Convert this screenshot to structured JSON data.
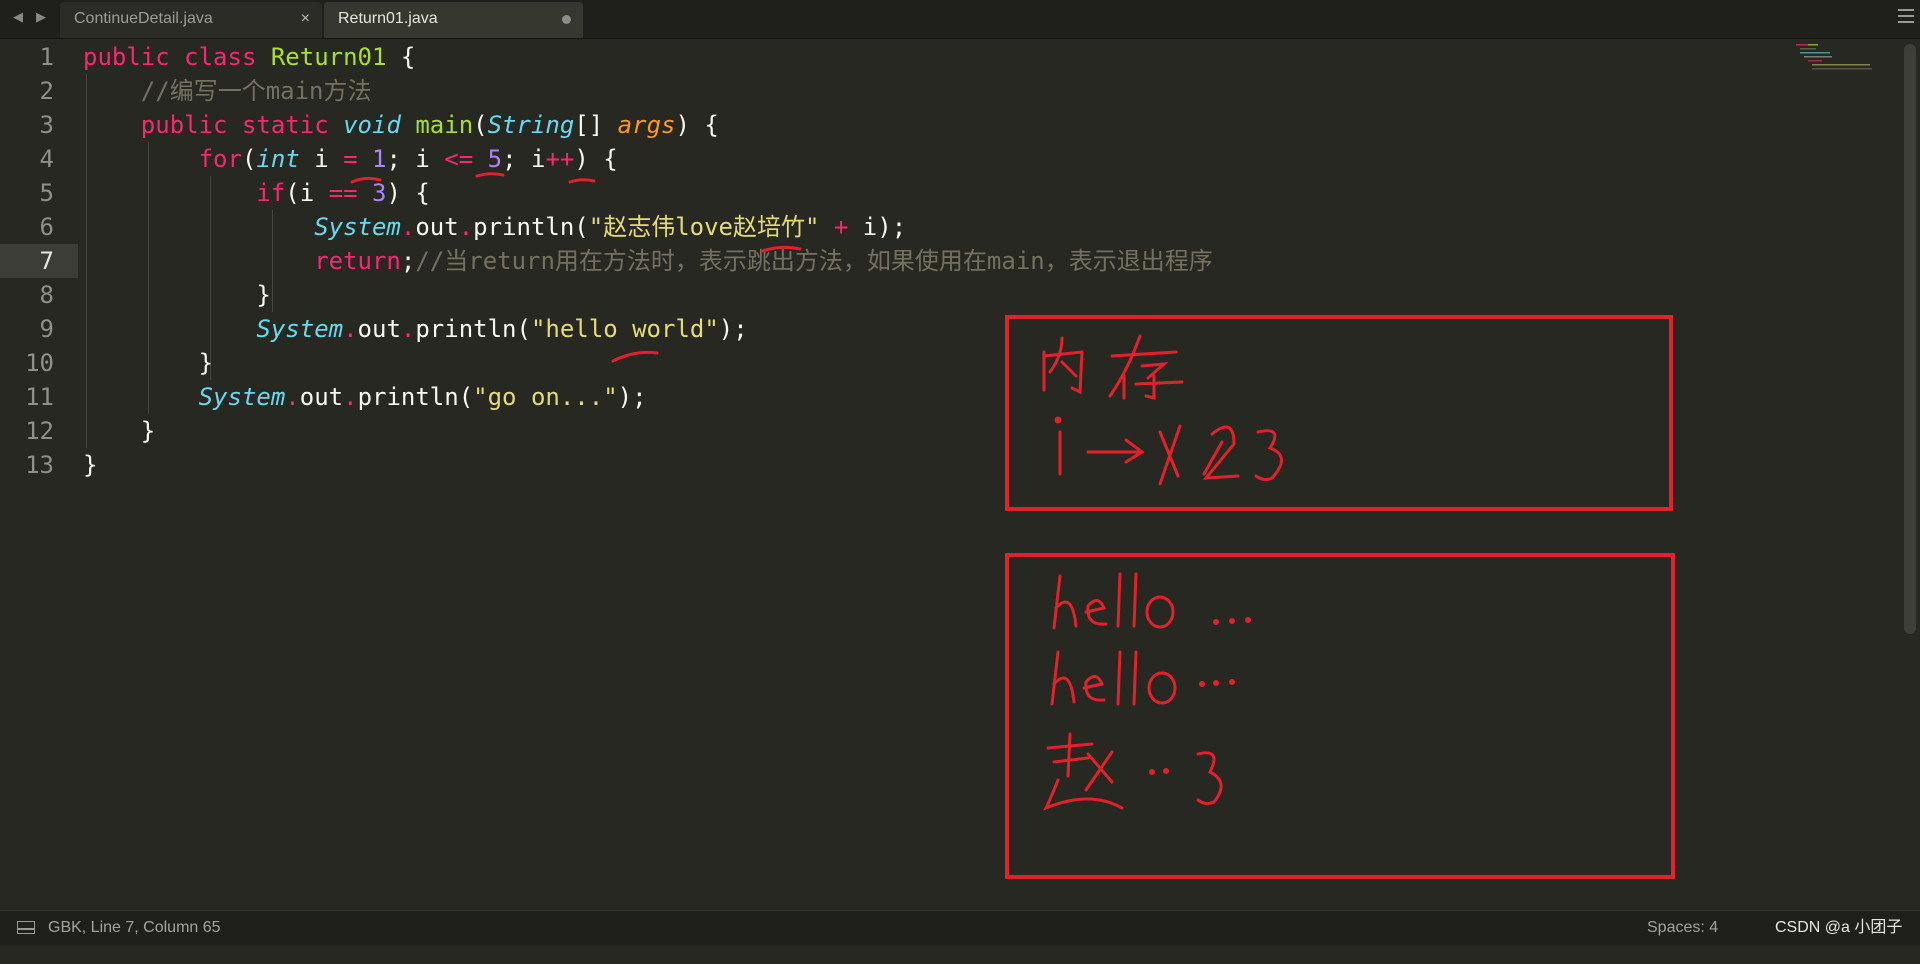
{
  "tabs": [
    {
      "label": "ContinueDetail.java",
      "active": false
    },
    {
      "label": "Return01.java",
      "active": true
    }
  ],
  "nav": {
    "back": "◀",
    "forward": "▶"
  },
  "tab_close": "×",
  "line_numbers": [
    "1",
    "2",
    "3",
    "4",
    "5",
    "6",
    "7",
    "8",
    "9",
    "10",
    "11",
    "12",
    "13"
  ],
  "code": {
    "l1": {
      "kw1": "public",
      "kw2": "class",
      "name": "Return01",
      "brace": "{"
    },
    "l2": {
      "comment": "//编写一个main方法"
    },
    "l3": {
      "kw1": "public",
      "kw2": "static",
      "type": "void",
      "fn": "main",
      "open": "(",
      "ptype": "String",
      "arr": "[]",
      "param": "args",
      "close": ") {"
    },
    "l4": {
      "kw": "for",
      "open": "(",
      "type": "int",
      "v1": " i ",
      "op1": "=",
      "n1": "1",
      "s1": "; i ",
      "op2": "<=",
      "n2": "5",
      "s2": "; i",
      "op3": "++",
      "close": ") {"
    },
    "l5": {
      "kw": "if",
      "open": "(i ",
      "op": "==",
      "n": "3",
      "close": ") {"
    },
    "l6": {
      "sys": "System",
      "dot1": ".",
      "out": "out",
      "dot2": ".",
      "call": "println(",
      "str": "\"赵志伟love赵培竹\"",
      "plus": "+",
      "rest": " i);"
    },
    "l7": {
      "kw": "return",
      "semi": ";",
      "comment": "//当return用在方法时，表示跳出方法，如果使用在main，表示退出程序"
    },
    "l8": {
      "brace": "}"
    },
    "l9": {
      "sys": "System",
      "dot1": ".",
      "out": "out",
      "dot2": ".",
      "call": "println(",
      "str": "\"hello world\"",
      "rest": ");"
    },
    "l10": {
      "brace": "}"
    },
    "l11": {
      "sys": "System",
      "dot1": ".",
      "out": "out",
      "dot2": ".",
      "call": "println(",
      "str": "\"go on...\"",
      "rest": ");"
    },
    "l12": {
      "brace": "}"
    },
    "l13": {
      "brace": "}"
    }
  },
  "annotations": {
    "memory_title": "内存",
    "memory_value": "i -> 1 2 3",
    "output_line1": "hello ...",
    "output_line2": "hello ...",
    "output_line3": "赵 ... 3"
  },
  "status": {
    "position": "GBK, Line 7, Column 65",
    "spaces": "Spaces: 4",
    "watermark": "CSDN @a 小团子"
  },
  "colors": {
    "background": "#272822",
    "annotation_red": "#e4202a",
    "keyword": "#f92672",
    "string": "#e6db74"
  }
}
